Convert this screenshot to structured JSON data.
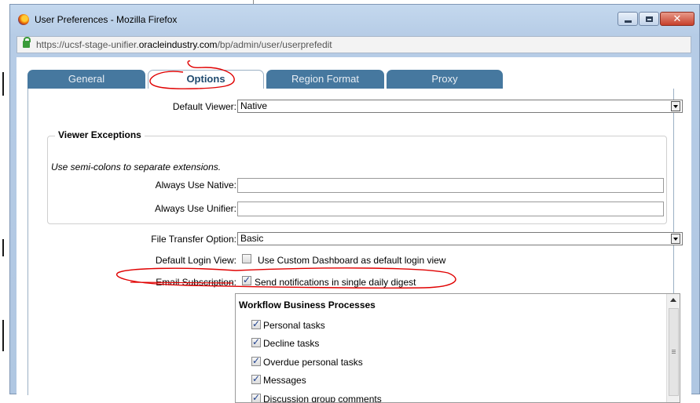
{
  "window": {
    "title": "User Preferences - Mozilla Firefox"
  },
  "urlbar": {
    "url_prefix": "https://ucsf-stage-unifier.",
    "url_domain": "oracleindustry.com",
    "url_suffix": "/bp/admin/user/userprefedit"
  },
  "tabs": [
    {
      "label": "General",
      "active": false
    },
    {
      "label": "Options",
      "active": true
    },
    {
      "label": "Region Format",
      "active": false
    },
    {
      "label": "Proxy",
      "active": false
    }
  ],
  "form": {
    "default_viewer_label": "Default Viewer:",
    "default_viewer_value": "Native",
    "viewer_exceptions_title": "Viewer Exceptions",
    "viewer_exceptions_hint": "Use semi-colons to separate extensions.",
    "always_native_label": "Always Use Native:",
    "always_native_value": "",
    "always_unifier_label": "Always Use Unifier:",
    "always_unifier_value": "",
    "file_transfer_label": "File Transfer Option:",
    "file_transfer_value": "Basic",
    "default_login_label": "Default Login View:",
    "default_login_checkbox_label": "Use Custom Dashboard as default login view",
    "default_login_checked": false,
    "email_subscription_label": "Email Subscription:",
    "email_subscription_checkbox_label": "Send notifications in single daily digest",
    "email_subscription_checked": true
  },
  "workflow": {
    "heading": "Workflow Business Processes",
    "items": [
      {
        "label": "Personal tasks",
        "checked": true
      },
      {
        "label": "Decline tasks",
        "checked": true
      },
      {
        "label": "Overdue personal tasks",
        "checked": true
      },
      {
        "label": "Messages",
        "checked": true
      },
      {
        "label": "Discussion group comments",
        "checked": true
      }
    ]
  },
  "colors": {
    "tab_bg": "#46789f",
    "active_tab_text": "#1f4a6e",
    "annotation_red": "#e00000"
  }
}
